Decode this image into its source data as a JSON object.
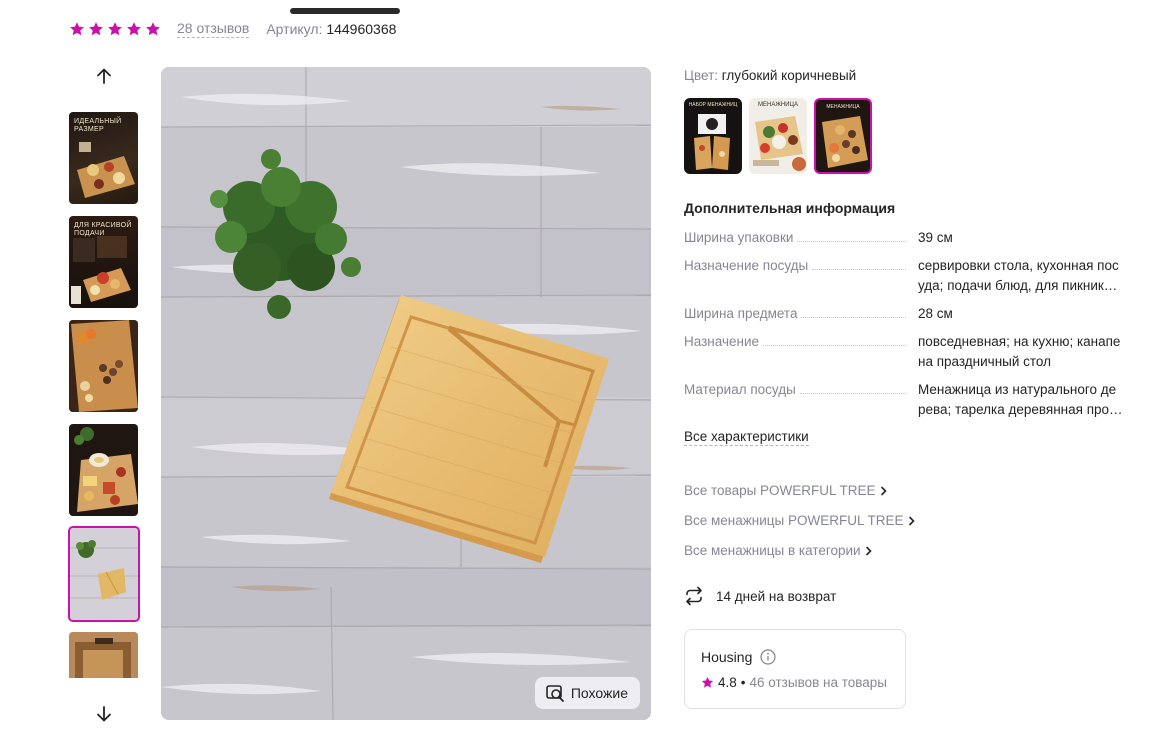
{
  "rating": {
    "stars": 5,
    "reviews_label": "28 отзывов",
    "article_label": "Артикул:",
    "article_value": "144960368"
  },
  "gallery": {
    "thumbs": [
      {
        "caption": "Идеальный размер",
        "name": "thumb-ideal-size"
      },
      {
        "caption": "Для красивой подачи",
        "name": "thumb-serving"
      },
      {
        "caption": "",
        "name": "thumb-food"
      },
      {
        "caption": "",
        "name": "thumb-snacks"
      },
      {
        "caption": "",
        "name": "thumb-plant-board",
        "active": true
      },
      {
        "caption": "",
        "name": "thumb-box"
      }
    ],
    "similar_label": "Похожие"
  },
  "color": {
    "label": "Цвет:",
    "value": "глубокий коричневый",
    "swatches": [
      {
        "caption": "Набор менажниц",
        "active": false
      },
      {
        "caption": "Менажница",
        "active": false
      },
      {
        "caption": "Менажница",
        "active": true
      }
    ]
  },
  "additional": {
    "title": "Дополнительная информация",
    "specs": [
      {
        "name": "Ширина упаковки",
        "value_lines": [
          "39 см"
        ]
      },
      {
        "name": "Назначение посуды",
        "value_lines": [
          "сервировки стола, кухонная пос",
          "уда; подачи блюд, для пикник…"
        ]
      },
      {
        "name": "Ширина предмета",
        "value_lines": [
          "28 см"
        ]
      },
      {
        "name": "Назначение",
        "value_lines": [
          "повседневная; на кухню; канапе",
          "на праздничный стол"
        ]
      },
      {
        "name": "Материал посуды",
        "value_lines": [
          "Менажница из натурального де",
          "рева; тарелка деревянная про…"
        ]
      }
    ],
    "all_label": "Все характеристики"
  },
  "links": [
    "Все товары POWERFUL TREE",
    "Все менажницы POWERFUL TREE",
    "Все менажницы в категории"
  ],
  "return_label": "14 дней на возврат",
  "seller": {
    "name": "Housing",
    "rating": "4.8",
    "separator": "•",
    "reviews": "46 отзывов на товары"
  },
  "colors": {
    "accent": "#cb11ab",
    "muted": "#868695",
    "text": "#242424"
  }
}
